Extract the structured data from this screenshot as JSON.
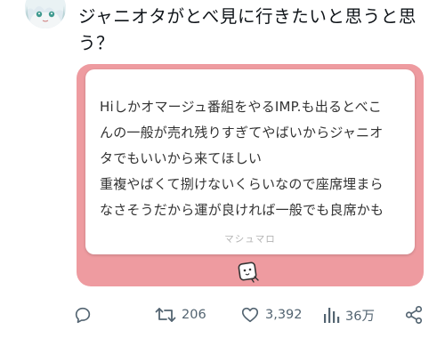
{
  "tweet": {
    "text": "ジャニオタがとべ見に行きたいと思うと思う？"
  },
  "card": {
    "lines": [
      "Hiしかオマージュ番組をやるIMP.も出るとべこ",
      "んの一般が売れ残りすぎてやばいからジャニオ",
      "タでもいいから来てほしい",
      "重複やばくて捌けないくらいなので座席埋まら",
      "なさそうだから運が良ければ一般でも良席かも"
    ],
    "footer": "マシュマロ"
  },
  "actions": {
    "reply_count": "",
    "retweet_count": "206",
    "like_count": "3,392",
    "views_count": "36万"
  },
  "colors": {
    "card_border": "#ee9ba0",
    "icon": "#536471"
  },
  "icons": [
    "avatar-image",
    "marshmallow-mascot-icon",
    "reply-icon",
    "retweet-icon",
    "like-icon",
    "views-icon",
    "share-icon"
  ]
}
